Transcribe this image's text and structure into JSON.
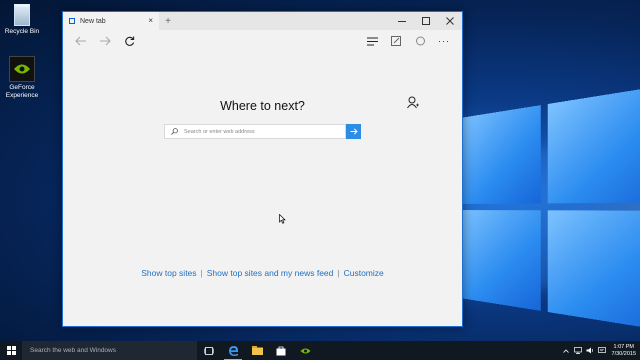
{
  "desktop": {
    "icons": [
      {
        "label": "Recycle Bin",
        "icon": "recycle-bin-icon"
      },
      {
        "label": "GeForce Experience",
        "icon": "geforce-icon"
      }
    ]
  },
  "browser": {
    "tab": {
      "title": "New tab",
      "close_icon": "close-icon"
    },
    "new_tab_icon": "plus-icon",
    "window_buttons": [
      "minimize-icon",
      "maximize-icon",
      "close-icon"
    ],
    "toolbar_icons": [
      "back-icon",
      "forward-icon",
      "refresh-icon",
      "hub-icon",
      "web-note-icon",
      "share-icon",
      "more-icon"
    ],
    "content": {
      "heading": "Where to next?",
      "search_placeholder": "Search or enter web address",
      "links": {
        "top_sites": "Show top sites",
        "top_sites_news": "Show top sites and my news feed",
        "customize": "Customize"
      }
    }
  },
  "taskbar": {
    "search_placeholder": "Search the web and Windows",
    "apps": [
      "task-view-icon",
      "edge-icon",
      "file-explorer-icon",
      "store-icon",
      "geforce-icon"
    ],
    "clock": {
      "time": "1:07 PM",
      "date": "7/30/2015"
    }
  },
  "colors": {
    "accent": "#2d8ce8",
    "link": "#2270c0",
    "taskbar": "#101822"
  }
}
